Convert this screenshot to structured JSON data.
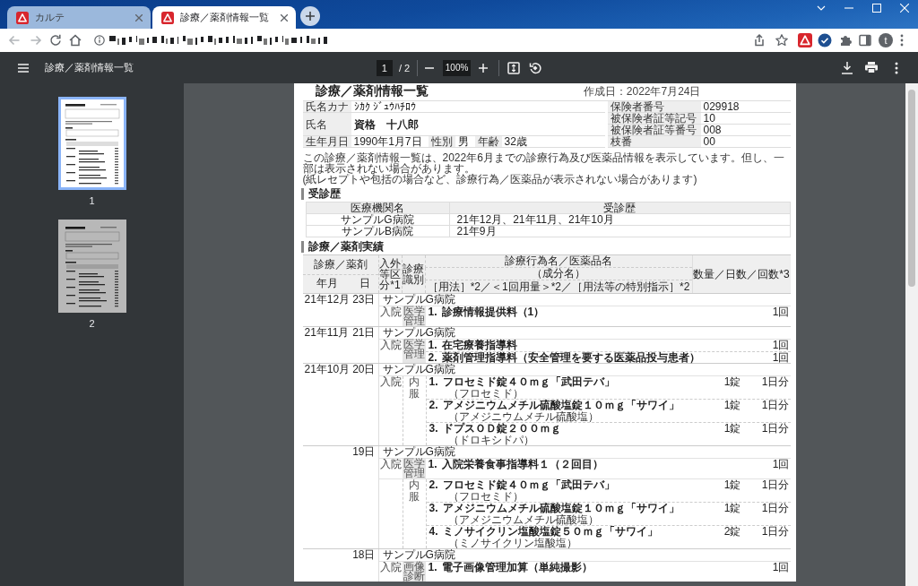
{
  "browser": {
    "tabs": [
      {
        "title": "カルテ",
        "selected": false
      },
      {
        "title": "診療／薬剤情報一覧",
        "selected": true
      }
    ],
    "profile_initial": "t"
  },
  "pdf_toolbar": {
    "title": "診療／薬剤情報一覧",
    "page": "1",
    "page_total": "/ 2",
    "zoom": "100%"
  },
  "thumbnails": [
    {
      "label": "1",
      "selected": true
    },
    {
      "label": "2",
      "selected": false
    }
  ],
  "document": {
    "title": "診療／薬剤情報一覧",
    "created": "作成日：2022年7月24日",
    "patient": {
      "kana_label": "氏名カナ",
      "kana": "ｼｶｸ ｼﾞｭｳﾊﾁﾛｳ",
      "name_label": "氏名",
      "name": "資格　十八郎",
      "birth_label": "生年月日",
      "birth": "1990年1月7日",
      "sex_label": "性別",
      "sex": "男",
      "age_label": "年齢",
      "age": "32歳",
      "insurance": [
        {
          "label": "保険者番号",
          "value": "029918"
        },
        {
          "label": "被保険者証等記号",
          "value": "10"
        },
        {
          "label": "被保険者証等番号",
          "value": "008"
        },
        {
          "label": "枝番",
          "value": "00"
        }
      ]
    },
    "notice": [
      "この診療／薬剤情報一覧は、2022年6月までの診療行為及び医薬品情報を表示しています。但し、一部は表示されない場合があります。",
      "(紙レセプトや包括の場合など、診療行為／医薬品が表示されない場合があります)"
    ],
    "visits": {
      "heading": "受診歴",
      "columns": [
        "医療機関名",
        "受診歴"
      ],
      "rows": [
        [
          "サンプルG病院",
          "21年12月、21年11月、21年10月"
        ],
        [
          "サンプルB病院",
          "21年9月"
        ]
      ]
    },
    "records": {
      "heading": "診療／薬剤実績",
      "header": {
        "treatment": "診療／薬剤",
        "month": "年月",
        "day": "日",
        "inout": "入外等区分*1",
        "category": "診療識別",
        "name": "診療行為名／医薬品名",
        "ingredient": "（成分名）",
        "usage": "［用法］*2／＜1回用量＞*2／［用法等の特別指示］*2",
        "quantity": "数量／日数／回数*3"
      },
      "groups": [
        {
          "month": "21年12月",
          "day": "23日",
          "hospital": "サンプルG病院",
          "sections": [
            {
              "kind": "procedure",
              "inout": "入院",
              "category": "医学管理",
              "items": [
                {
                  "no": "1.",
                  "name": "診療情報提供料（1）",
                  "quantity": "1回"
                }
              ]
            }
          ]
        },
        {
          "month": "21年11月",
          "day": "21日",
          "hospital": "サンプルG病院",
          "sections": [
            {
              "kind": "procedure",
              "inout": "入院",
              "category": "医学管理",
              "items": [
                {
                  "no": "1.",
                  "name": "在宅療養指導料",
                  "quantity": "1回"
                },
                {
                  "no": "2.",
                  "name": "薬剤管理指導料（安全管理を要する医薬品投与患者）",
                  "quantity": "1回"
                }
              ]
            }
          ]
        },
        {
          "month": "21年10月",
          "day": "20日",
          "hospital": "サンプルG病院",
          "sections": [
            {
              "kind": "medicine",
              "inout": "入院",
              "category": "内服",
              "items": [
                {
                  "no": "1.",
                  "name": "フロセミド錠４０ｍｇ「武田テバ」",
                  "ingredient": "（フロセミド）",
                  "dose": "1錠",
                  "quantity": "1日分"
                },
                {
                  "no": "2.",
                  "name": "アメジニウムメチル硫酸塩錠１０ｍｇ「サワイ」",
                  "ingredient": "（アメジニウムメチル硫酸塩）",
                  "dose": "1錠",
                  "quantity": "1日分"
                },
                {
                  "no": "3.",
                  "name": "ドプスＯＤ錠２００ｍｇ",
                  "ingredient": "（ドロキシドパ）",
                  "dose": "1錠",
                  "quantity": "1日分"
                }
              ]
            }
          ]
        },
        {
          "day": "19日",
          "hospital": "サンプルG病院",
          "sections": [
            {
              "kind": "procedure",
              "inout": "入院",
              "category": "医学管理",
              "items": [
                {
                  "no": "1.",
                  "name": "入院栄養食事指導料１（２回目）",
                  "quantity": "1回"
                }
              ]
            },
            {
              "kind": "medicine",
              "category": "内服",
              "items": [
                {
                  "no": "2.",
                  "name": "フロセミド錠４０ｍｇ「武田テバ」",
                  "ingredient": "（フロセミド）",
                  "dose": "1錠",
                  "quantity": "1日分"
                },
                {
                  "no": "3.",
                  "name": "アメジニウムメチル硫酸塩錠１０ｍｇ「サワイ」",
                  "ingredient": "（アメジニウムメチル硫酸塩）",
                  "dose": "1錠",
                  "quantity": "1日分"
                },
                {
                  "no": "4.",
                  "name": "ミノサイクリン塩酸塩錠５０ｍｇ「サワイ」",
                  "ingredient": "（ミノサイクリン塩酸塩）",
                  "dose": "2錠",
                  "quantity": "1日分"
                }
              ]
            }
          ]
        },
        {
          "day": "18日",
          "hospital": "サンプルG病院",
          "sections": [
            {
              "kind": "procedure",
              "inout": "入院",
              "category": "画像診断",
              "items": [
                {
                  "no": "1.",
                  "name": "電子画像管理加算（単純撮影）",
                  "quantity": "1回"
                }
              ]
            }
          ]
        }
      ]
    }
  }
}
